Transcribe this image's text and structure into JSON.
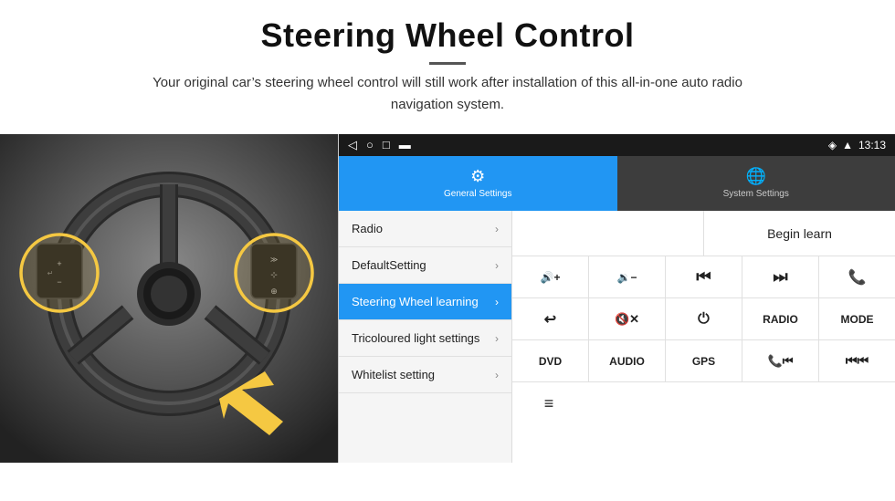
{
  "header": {
    "title": "Steering Wheel Control",
    "subtitle": "Your original car’s steering wheel control will still work after installation of this all-in-one auto radio navigation system."
  },
  "status_bar": {
    "nav_back": "◁",
    "nav_home": "○",
    "nav_recent": "□",
    "nav_extra": "█",
    "signal_icon": "★",
    "wifi_icon": "▲",
    "time": "13:13"
  },
  "tabs": [
    {
      "id": "general",
      "icon": "⚙",
      "label": "General Settings",
      "active": true
    },
    {
      "id": "system",
      "icon": "ἱ0",
      "label": "System Settings",
      "active": false
    }
  ],
  "menu_items": [
    {
      "label": "Radio",
      "active": false
    },
    {
      "label": "DefaultSetting",
      "active": false
    },
    {
      "label": "Steering Wheel learning",
      "active": true
    },
    {
      "label": "Tricoloured light settings",
      "active": false
    },
    {
      "label": "Whitelist setting",
      "active": false
    }
  ],
  "control_panel": {
    "begin_learn": "Begin learn",
    "row2": [
      {
        "icon": "🔊+",
        "label": "vol_up"
      },
      {
        "icon": "🔊−",
        "label": "vol_down"
      },
      {
        "icon": "⏮",
        "label": "prev"
      },
      {
        "icon": "⏭",
        "label": "next"
      },
      {
        "icon": "📞",
        "label": "phone"
      }
    ],
    "row3": [
      {
        "icon": "↩",
        "label": "back"
      },
      {
        "icon": "🔇×",
        "label": "mute"
      },
      {
        "icon": "⏻",
        "label": "power"
      },
      {
        "text": "RADIO",
        "label": "radio_btn"
      },
      {
        "text": "MODE",
        "label": "mode_btn"
      }
    ],
    "row4": [
      {
        "text": "DVD",
        "label": "dvd"
      },
      {
        "text": "AUDIO",
        "label": "audio"
      },
      {
        "text": "GPS",
        "label": "gps"
      },
      {
        "icon": "📞⏮",
        "label": "phone_prev"
      },
      {
        "icon": "⏮⏮",
        "label": "rew"
      }
    ],
    "row5": [
      {
        "icon": "≡▤",
        "label": "menu_icon"
      }
    ]
  }
}
